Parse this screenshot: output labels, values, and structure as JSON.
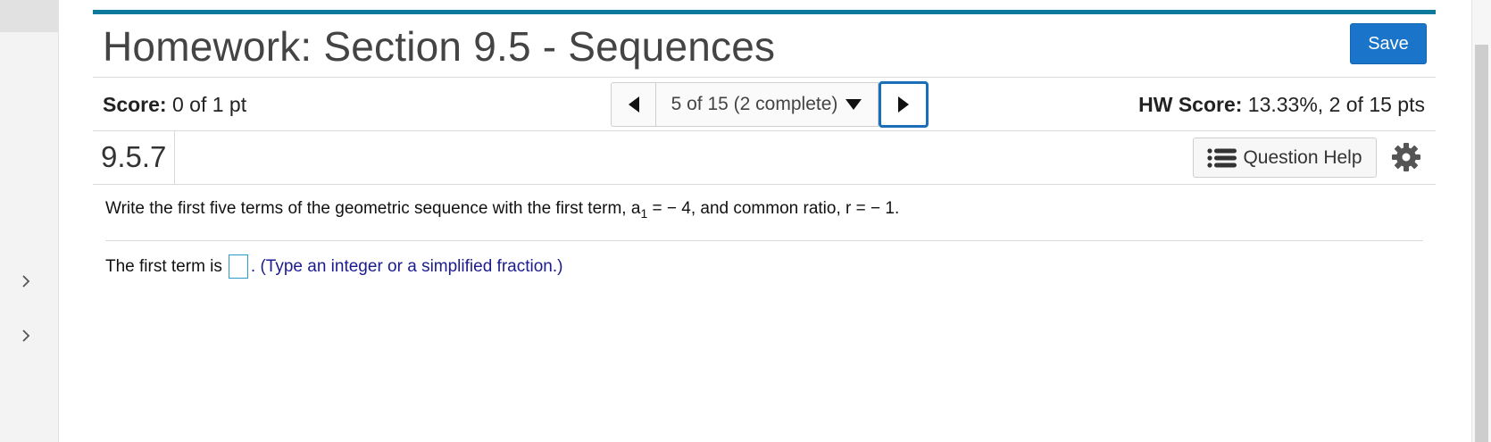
{
  "sidebar": {
    "expanders": [
      {
        "name": "expand-panel-1"
      },
      {
        "name": "expand-panel-2"
      }
    ]
  },
  "header": {
    "title": "Homework: Section 9.5 - Sequences",
    "save_label": "Save"
  },
  "score": {
    "label": "Score:",
    "value": "0 of 1 pt",
    "hw_label": "HW Score:",
    "hw_value": "13.33%, 2 of 15 pts"
  },
  "pager": {
    "current": "5 of 15 (2 complete)"
  },
  "question": {
    "number": "9.5.7",
    "help_label": "Question Help",
    "prompt_before": "Write the first five terms of the geometric sequence with the first term, a",
    "prompt_sub": "1",
    "prompt_after": " = − 4, and common ratio, r = − 1.",
    "answer_prefix": "The first term is",
    "answer_value": "",
    "answer_hint": ". (Type an integer or a simplified fraction.)"
  },
  "colors": {
    "accent_bar": "#0b7a9c",
    "save_button": "#1a74c9",
    "hint_text": "#1b1b8f",
    "next_focus": "#1a6fb8"
  }
}
